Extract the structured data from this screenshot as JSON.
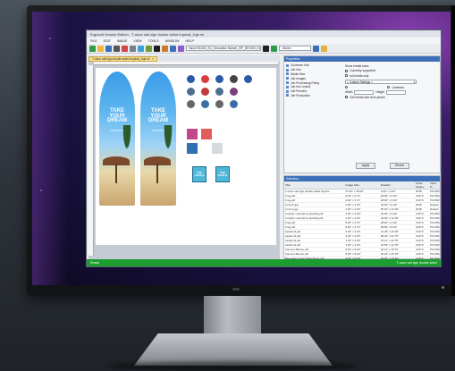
{
  "window": {
    "title": "Ergosoft Version Edition - T-razor sail sign double sided tropical_Joje.ml"
  },
  "menu": {
    "items": [
      "FILE",
      "EDIT",
      "IMAGE",
      "VIEW",
      "TOOLS",
      "WINDOW",
      "HELP"
    ]
  },
  "toolbar": {
    "job_field": "Import 80.640_SC_Decoration Banner_ISP_NEV400_01",
    "search_field": "<None>"
  },
  "document_tab": {
    "label": "T-razor sail sign double sided tropical_Joje.ml"
  },
  "artwork": {
    "flag_headline": "TAKE YOUR DREAM",
    "flag_subline": "VACATION",
    "card_label": "THE POOLS"
  },
  "properties": {
    "header": "Properties",
    "tree": [
      "Customer Info",
      "Job Info",
      "Media Size",
      "Job Images",
      "Job Processing Policy",
      "Job Ink Control",
      "Job Preview",
      "Job Production"
    ],
    "show_media_sizes": "Show media sizes",
    "currently_supported": "Currently supported",
    "roll_media_only": "roll media only",
    "media_select": "< Custom Settings >",
    "option_centered": "Centered",
    "width_label": "Width",
    "height_label": "Height",
    "use_media_size": "Get media size from printer",
    "apply_label": "Apply",
    "revert_label": "Revert"
  },
  "selection": {
    "header": "Selection",
    "columns": [
      "Title",
      "Image Size",
      "Position",
      "Color Space",
      "Input P..."
    ],
    "rows": [
      [
        "T-razor sail sign double sided tropica...",
        "27.62\" x 46.09\"",
        "0.00\" x 0.00\"",
        "RGB",
        "PS-PDF"
      ],
      [
        "Frog.pdf",
        "8.00\" x 3.74\"",
        "28.84\" x 0.00\"",
        "CMYK",
        "PS-PDF"
      ],
      [
        "Frog.pdf",
        "8.00\" x 3.74\"",
        "28.84\" x 4.00\"",
        "CMYK",
        "PS-PDF"
      ],
      [
        "Cosmic.jpg",
        "2.00\" x 2.00\"",
        "30.00\" x 9.00\"",
        "RGB",
        "Default"
      ],
      [
        "Cosmo.jpg",
        "2.00\" x 2.00\"",
        "30.00\" x 12.00\"",
        "RGB",
        "Default"
      ],
      [
        "Coaster metroshiny butterfly.pdf",
        "2.00\" x 2.00\"",
        "32.50\" x 9.00\"",
        "CMYK",
        "PS-PDF"
      ],
      [
        "Coaster metroshiny butterfly.pdf",
        "2.00\" x 2.00\"",
        "32.50\" x 12.00\"",
        "CMYK",
        "PS-PDF"
      ],
      [
        "Frog.pdf",
        "8.00\" x 3.74\"",
        "28.84\" x 4.00\"",
        "CMYK",
        "PS-PDF"
      ],
      [
        "Frog.pdf",
        "8.00\" x 3.74\"",
        "28.84\" x 8.00\"",
        "CMYK",
        "PS-PDF"
      ],
      [
        "cadetmnl.pdf",
        "3.25\" x 3.25\"",
        "31.39\" x 19.00\"",
        "CMYK",
        "PS-PDF"
      ],
      [
        "cadetmnl.pdf",
        "3.25\" x 3.25\"",
        "28.09\" x 22.75\"",
        "CMYK",
        "PS-PDF"
      ],
      [
        "cadetmnl.pdf",
        "3.25\" x 3.25\"",
        "31.11\" x 22.75\"",
        "CMYK",
        "PS-PDF"
      ],
      [
        "cadetmnl.pdf",
        "3.25\" x 3.25\"",
        "40.56\" x 22.75\"",
        "CMYK",
        "PS-PDF"
      ],
      [
        "Famous Bameo.pdf",
        "8.00\" x 8.00\"",
        "40.11\" x 19.75\"",
        "CMYK",
        "PS-PDF"
      ],
      [
        "Famous Bameo.pdf",
        "8.00\" x 8.00\"",
        "29.00\" x 19.75\"",
        "CMYK",
        "PS-PDF"
      ],
      [
        "Beverage Cooler Data Sheet.pdf",
        "8.00\" x 8.00\"",
        "29.56\" x 19.45\"",
        "CMYK",
        "PS-PDF"
      ],
      [
        "Beverage Cooler Data Sheet.pdf",
        "8.00\" x 8.00\"",
        "33.56\" x 22.75\"",
        "CMYK",
        "PS-PDF"
      ]
    ]
  },
  "statusbar": {
    "left": "Ready",
    "right": "T-razor sail sign double sided"
  },
  "colors": {
    "accent": "#3c6fb7",
    "status": "#1b9d2f",
    "tab": "#f9e089"
  }
}
